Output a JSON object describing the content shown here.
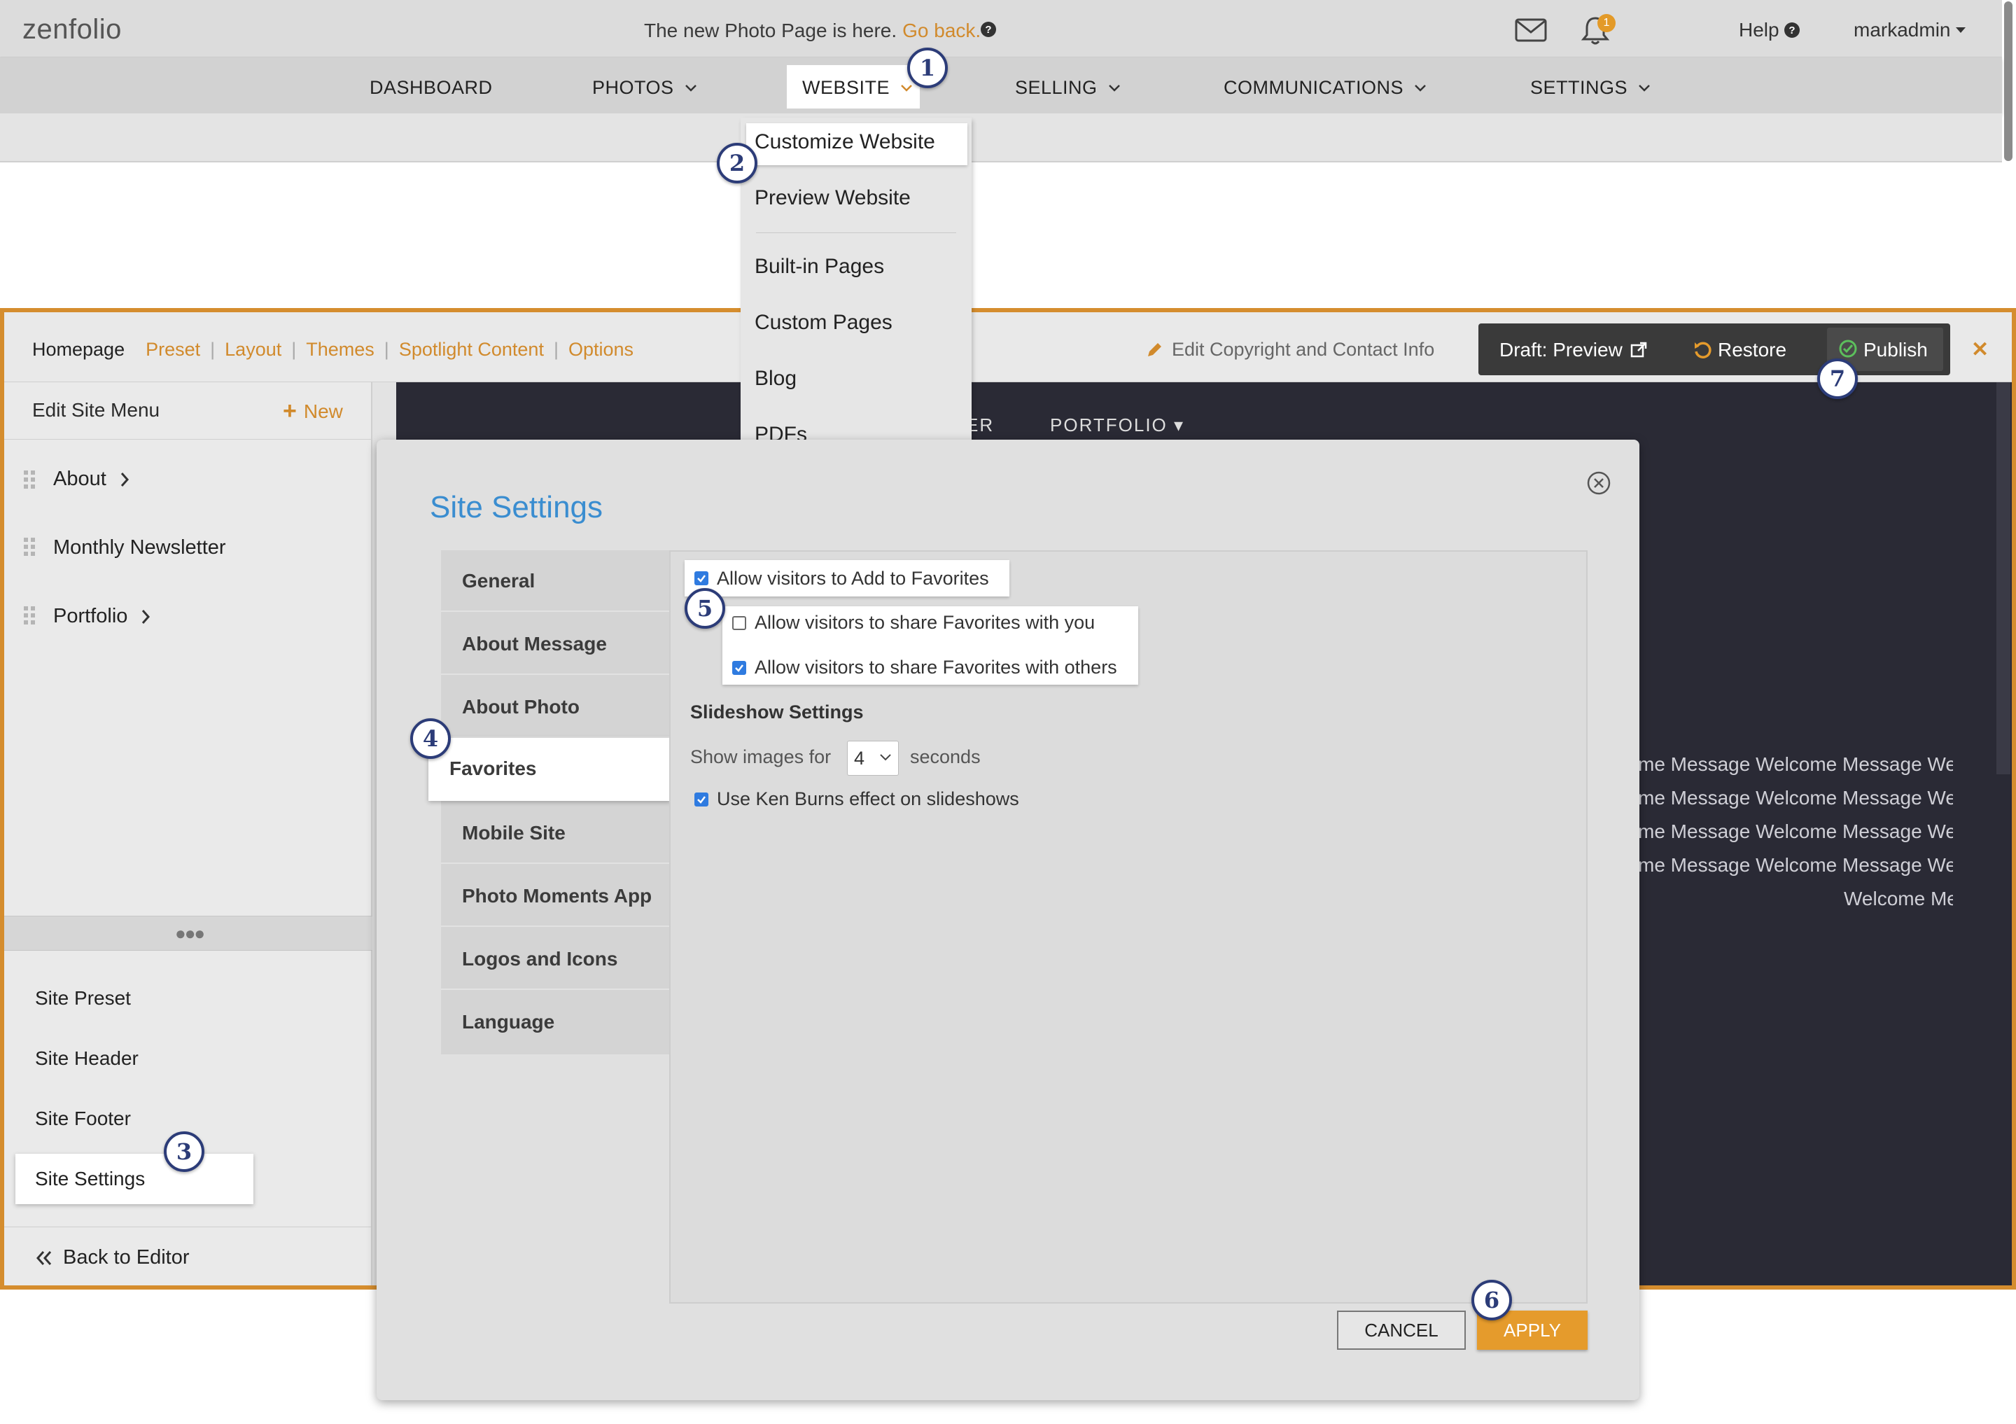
{
  "topbar": {
    "logo": "zenfolio",
    "announcement": "The new Photo Page is here.",
    "go_back": "Go back.",
    "notification_count": "1",
    "help": "Help",
    "user": "markadmin"
  },
  "nav": {
    "dashboard": "DASHBOARD",
    "photos": "PHOTOS",
    "website": "WEBSITE",
    "selling": "SELLING",
    "communications": "COMMUNICATIONS",
    "settings": "SETTINGS"
  },
  "website_dropdown": {
    "items": [
      "Customize Website",
      "Preview Website",
      "Built-in Pages",
      "Custom Pages",
      "Blog",
      "PDFs"
    ]
  },
  "editor": {
    "tabs": [
      "Homepage",
      "Preset",
      "Layout",
      "Themes",
      "Spotlight Content",
      "Options"
    ],
    "edit_copyright": "Edit Copyright and Contact Info",
    "draft_preview": "Draft: Preview",
    "restore": "Restore",
    "publish": "Publish"
  },
  "left_panel": {
    "menu_title": "Edit Site Menu",
    "new_label": "New",
    "menu_items": [
      "About",
      "Monthly Newsletter",
      "Portfolio"
    ],
    "site_items": [
      "Site Preset",
      "Site Header",
      "Site Footer",
      "Site Settings"
    ],
    "back_to_editor": "Back to Editor"
  },
  "preview": {
    "nav_partial": "ER",
    "nav_portfolio": "PORTFOLIO ▾",
    "lines": [
      "me  Message Welcome  Message We",
      "me  Message Welcome  Message We",
      "me  Message Welcome  Message We",
      "me  Message Welcome  Message We",
      "Welcome  Me"
    ]
  },
  "modal": {
    "title": "Site Settings",
    "tabs": [
      "General",
      "About Message",
      "About Photo",
      "Favorites",
      "Mobile Site",
      "Photo Moments App",
      "Logos and Icons",
      "Language"
    ],
    "active_tab": "Favorites",
    "fav_add": "Allow visitors to Add to Favorites",
    "fav_share_you": "Allow visitors to share Favorites with you",
    "fav_share_others": "Allow visitors to share Favorites with others",
    "slideshow_title": "Slideshow Settings",
    "show_images_for": "Show images for",
    "show_images_value": "4",
    "seconds": "seconds",
    "ken_burns": "Use Ken Burns effect on slideshows",
    "cancel": "CANCEL",
    "apply": "APPLY"
  },
  "steps": [
    "1",
    "2",
    "3",
    "4",
    "5",
    "6",
    "7"
  ],
  "colors": {
    "accent": "#d18a2c",
    "step": "#2c3c78",
    "title_blue": "#3a8dd0"
  }
}
